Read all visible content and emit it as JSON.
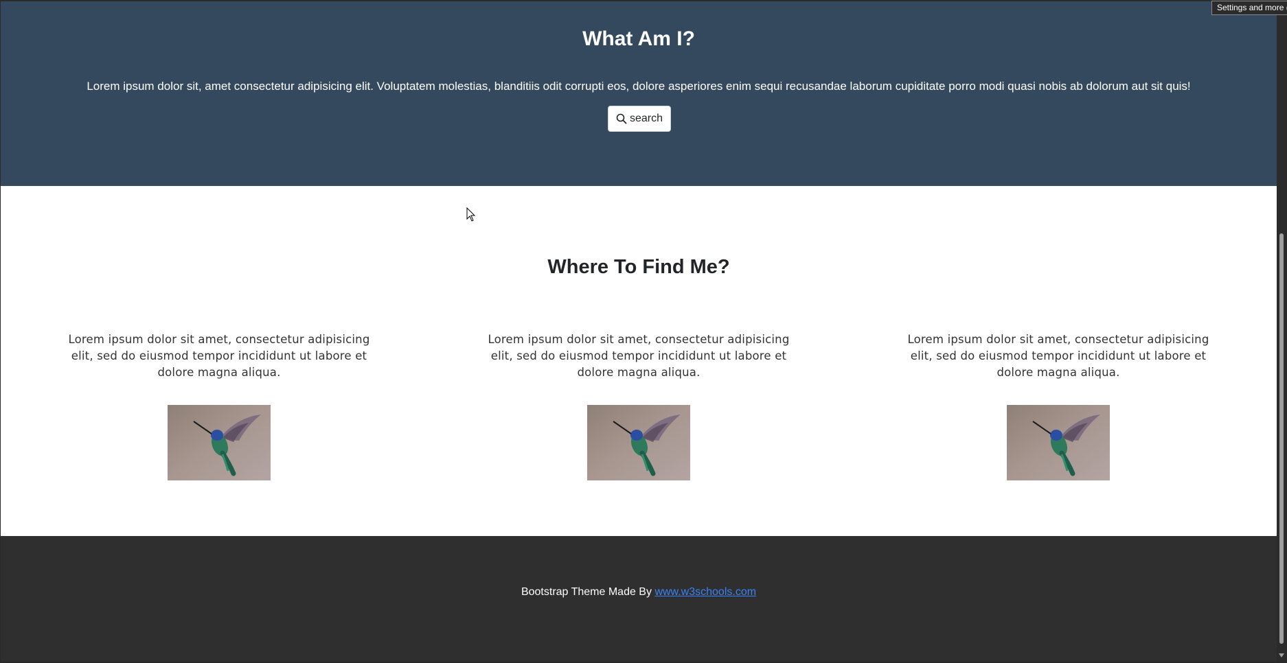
{
  "hero": {
    "title": "What Am I?",
    "text": "Lorem ipsum dolor sit, amet consectetur adipisicing elit. Voluptatem molestias, blanditiis odit corrupti eos, dolore asperiores enim sequi recusandae laborum cupiditate porro modi quasi nobis ab dolorum aut sit quis!",
    "search_label": "search",
    "search_icon": "search-icon"
  },
  "find": {
    "title": "Where To Find Me?",
    "columns": [
      {
        "text": "Lorem ipsum dolor sit amet, consectetur adipisicing elit, sed do eiusmod tempor incididunt ut labore et dolore magna aliqua.",
        "image": "hummingbird-image"
      },
      {
        "text": "Lorem ipsum dolor sit amet, consectetur adipisicing elit, sed do eiusmod tempor incididunt ut labore et dolore magna aliqua.",
        "image": "hummingbird-image"
      },
      {
        "text": "Lorem ipsum dolor sit amet, consectetur adipisicing elit, sed do eiusmod tempor incididunt ut labore et dolore magna aliqua.",
        "image": "hummingbird-image"
      }
    ]
  },
  "footer": {
    "text": "Bootstrap Theme Made By",
    "link": "www.w3schools.com"
  },
  "tooltip": "Settings and more (Alt+F)",
  "colors": {
    "hero_bg": "#34495e",
    "footer_bg": "#2f2f2f",
    "link": "#3b82f6"
  }
}
